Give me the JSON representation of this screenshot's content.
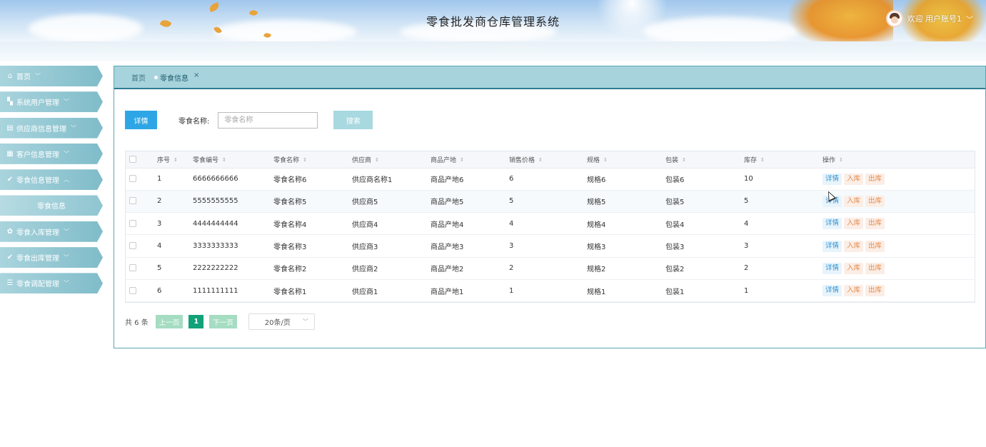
{
  "header": {
    "title": "零食批发商仓库管理系统",
    "user_greeting": "欢迎 用户账号1",
    "user_caret": "﹀"
  },
  "sidebar": {
    "items": [
      {
        "label": "首页",
        "icon": "home-icon",
        "glyph": "⌂",
        "caret": "﹀"
      },
      {
        "label": "系统用户管理",
        "icon": "user-manage-icon",
        "glyph": "▚",
        "caret": "﹀"
      },
      {
        "label": "供应商信息管理",
        "icon": "supplier-icon",
        "glyph": "▤",
        "caret": "﹀"
      },
      {
        "label": "客户信息管理",
        "icon": "customer-icon",
        "glyph": "▦",
        "caret": "﹀"
      },
      {
        "label": "零食信息管理",
        "icon": "snack-info-icon",
        "glyph": "✔",
        "caret": "︿"
      },
      {
        "label": "零食信息",
        "sub": true
      },
      {
        "label": "零食入库管理",
        "icon": "stock-in-icon",
        "glyph": "✿",
        "caret": "﹀"
      },
      {
        "label": "零食出库管理",
        "icon": "stock-out-icon",
        "glyph": "✔",
        "caret": "﹀"
      },
      {
        "label": "零食调配管理",
        "icon": "allocation-icon",
        "glyph": "☰",
        "caret": "﹀"
      }
    ]
  },
  "tabs": {
    "home": "首页",
    "current": "零食信息",
    "close": "×"
  },
  "toolbar": {
    "detail_label": "详情",
    "search_label": "零食名称:",
    "search_placeholder": "零食名称",
    "search_button": "搜索"
  },
  "table": {
    "columns": [
      "序号",
      "零食编号",
      "零食名称",
      "供应商",
      "商品产地",
      "销售价格",
      "规格",
      "包装",
      "库存",
      "操作"
    ],
    "sort_glyph": "⇕",
    "rows": [
      {
        "index": "1",
        "code": "6666666666",
        "name": "零食名称6",
        "supplier": "供应商名称1",
        "origin": "商品产地6",
        "price": "6",
        "spec": "规格6",
        "pack": "包装6",
        "stock": "10"
      },
      {
        "index": "2",
        "code": "5555555555",
        "name": "零食名称5",
        "supplier": "供应商5",
        "origin": "商品产地5",
        "price": "5",
        "spec": "规格5",
        "pack": "包装5",
        "stock": "5"
      },
      {
        "index": "3",
        "code": "4444444444",
        "name": "零食名称4",
        "supplier": "供应商4",
        "origin": "商品产地4",
        "price": "4",
        "spec": "规格4",
        "pack": "包装4",
        "stock": "4"
      },
      {
        "index": "4",
        "code": "3333333333",
        "name": "零食名称3",
        "supplier": "供应商3",
        "origin": "商品产地3",
        "price": "3",
        "spec": "规格3",
        "pack": "包装3",
        "stock": "3"
      },
      {
        "index": "5",
        "code": "2222222222",
        "name": "零食名称2",
        "supplier": "供应商2",
        "origin": "商品产地2",
        "price": "2",
        "spec": "规格2",
        "pack": "包装2",
        "stock": "2"
      },
      {
        "index": "6",
        "code": "1111111111",
        "name": "零食名称1",
        "supplier": "供应商1",
        "origin": "商品产地1",
        "price": "1",
        "spec": "规格1",
        "pack": "包装1",
        "stock": "1"
      }
    ],
    "actions": {
      "detail": "详情",
      "in": "入库",
      "out": "出库"
    }
  },
  "pagination": {
    "total": "共 6 条",
    "prev": "上一页",
    "page": "1",
    "next": "下一页",
    "page_size": "20条/页",
    "chevron": "﹀"
  },
  "colors": {
    "accent": "#2ea6e6",
    "sidebar": "#7fbcc9",
    "tabbar": "#a7d3dd",
    "page_active": "#12a179"
  }
}
